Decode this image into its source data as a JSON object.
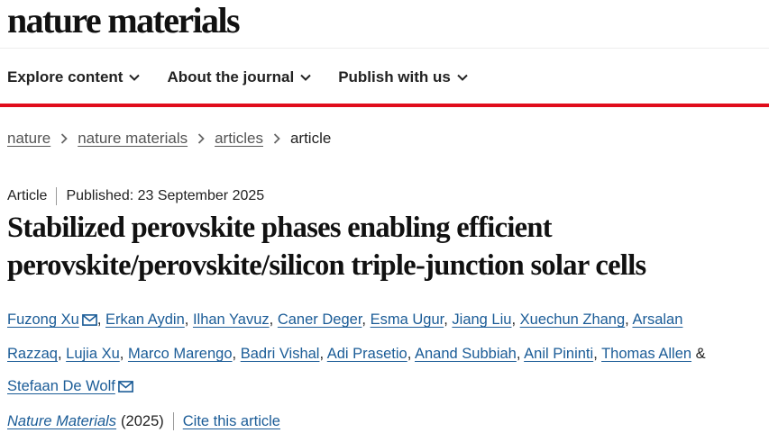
{
  "site": {
    "logo": "nature materials"
  },
  "nav": {
    "items": [
      {
        "label": "Explore content"
      },
      {
        "label": "About the journal"
      },
      {
        "label": "Publish with us"
      }
    ]
  },
  "breadcrumb": {
    "items": [
      "nature",
      "nature materials",
      "articles"
    ],
    "current": "article"
  },
  "article": {
    "type": "Article",
    "published": "Published: 23 September 2025",
    "title_line1": "Stabilized perovskite phases enabling efficient",
    "title_line2": "perovskite/perovskite/silicon triple-junction solar cells",
    "authors": [
      "Fuzong Xu",
      "Erkan Aydin",
      "Ilhan Yavuz",
      "Caner Deger",
      "Esma Ugur",
      "Jiang Liu",
      "Xuechun Zhang",
      "Arsalan",
      "Razzaq",
      "Lujia Xu",
      "Marco Marengo",
      "Badri Vishal",
      "Adi Prasetio",
      "Anand Subbiah",
      "Anil Pininti",
      "Thomas Allen",
      "Stefaan De Wolf"
    ],
    "separators": {
      "comma": ",",
      "amp": "&"
    },
    "journal": "Nature Materials",
    "year": "(2025)",
    "cite_label": "Cite this article"
  },
  "colors": {
    "accent_red": "#e00d1b",
    "link_blue": "#1b5c97"
  },
  "icons": [
    "chevron-down-icon",
    "chevron-right-icon",
    "mail-icon"
  ]
}
